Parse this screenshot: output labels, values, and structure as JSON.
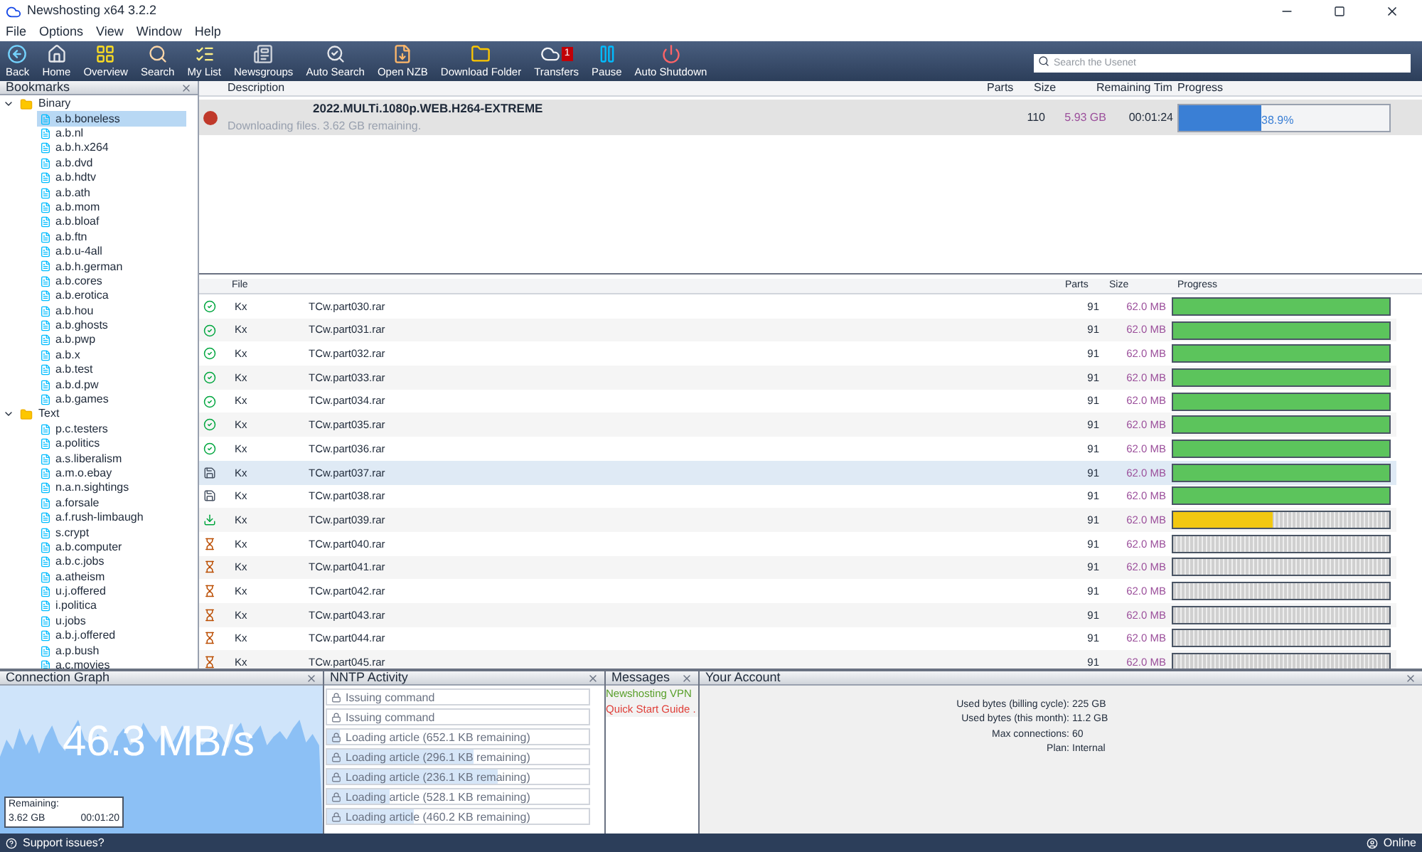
{
  "window": {
    "title": "Newshosting x64 3.2.2"
  },
  "menu": [
    "File",
    "Options",
    "View",
    "Window",
    "Help"
  ],
  "toolbar": [
    {
      "label": "Back"
    },
    {
      "label": "Home"
    },
    {
      "label": "Overview"
    },
    {
      "label": "Search"
    },
    {
      "label": "My List"
    },
    {
      "label": "Newsgroups"
    },
    {
      "label": "Auto Search"
    },
    {
      "label": "Open NZB"
    },
    {
      "label": "Download Folder"
    },
    {
      "label": "Transfers",
      "badge": "1"
    },
    {
      "label": "Pause"
    },
    {
      "label": "Auto Shutdown"
    }
  ],
  "search": {
    "placeholder": "Search the Usenet"
  },
  "bookmarks": {
    "title": "Bookmarks",
    "groups": [
      {
        "label": "Binary",
        "expanded": true,
        "children": [
          {
            "label": "a.b.boneless",
            "selected": true
          },
          {
            "label": "a.b.nl",
            "selected": false
          },
          {
            "label": "a.b.h.x264",
            "selected": false
          },
          {
            "label": "a.b.dvd",
            "selected": false
          },
          {
            "label": "a.b.hdtv",
            "selected": false
          },
          {
            "label": "a.b.ath",
            "selected": false
          },
          {
            "label": "a.b.mom",
            "selected": false
          },
          {
            "label": "a.b.bloaf",
            "selected": false
          },
          {
            "label": "a.b.ftn",
            "selected": false
          },
          {
            "label": "a.b.u-4all",
            "selected": false
          },
          {
            "label": "a.b.h.german",
            "selected": false
          },
          {
            "label": "a.b.cores",
            "selected": false
          },
          {
            "label": "a.b.erotica",
            "selected": false
          },
          {
            "label": "a.b.hou",
            "selected": false
          },
          {
            "label": "a.b.ghosts",
            "selected": false
          },
          {
            "label": "a.b.pwp",
            "selected": false
          },
          {
            "label": "a.b.x",
            "selected": false
          },
          {
            "label": "a.b.test",
            "selected": false
          },
          {
            "label": "a.b.d.pw",
            "selected": false
          },
          {
            "label": "a.b.games",
            "selected": false
          }
        ]
      },
      {
        "label": "Text",
        "expanded": true,
        "children": [
          {
            "label": "p.c.testers",
            "selected": false
          },
          {
            "label": "a.politics",
            "selected": false
          },
          {
            "label": "a.s.liberalism",
            "selected": false
          },
          {
            "label": "a.m.o.ebay",
            "selected": false
          },
          {
            "label": "n.a.n.sightings",
            "selected": false
          },
          {
            "label": "a.forsale",
            "selected": false
          },
          {
            "label": "a.f.rush-limbaugh",
            "selected": false
          },
          {
            "label": "s.crypt",
            "selected": false
          },
          {
            "label": "a.b.computer",
            "selected": false
          },
          {
            "label": "a.b.c.jobs",
            "selected": false
          },
          {
            "label": "a.atheism",
            "selected": false
          },
          {
            "label": "u.j.offered",
            "selected": false
          },
          {
            "label": "i.politica",
            "selected": false
          },
          {
            "label": "u.jobs",
            "selected": false
          },
          {
            "label": "a.b.j.offered",
            "selected": false
          },
          {
            "label": "a.p.bush",
            "selected": false
          },
          {
            "label": "a.c.movies",
            "selected": false
          }
        ]
      }
    ]
  },
  "jobs": {
    "columns": [
      "Description",
      "Parts",
      "Size",
      "Remaining Tim",
      "Progress"
    ],
    "rows": [
      {
        "title": "2022.MULTi.1080p.WEB.H264-EXTREME",
        "status": "Downloading files. 3.62 GB remaining.",
        "parts": "110",
        "size": "5.93 GB",
        "remaining": "00:01:24",
        "level": 0.389,
        "percent": "38.9%"
      }
    ]
  },
  "files": {
    "columns": [
      "File",
      "Parts",
      "Size",
      "Progress"
    ],
    "rows": [
      {
        "kind": "done",
        "poster": "Kx",
        "name": "TCw.part030.rar",
        "parts": "91",
        "size": "62.0 MB",
        "level": 1,
        "selected": false
      },
      {
        "kind": "done",
        "poster": "Kx",
        "name": "TCw.part031.rar",
        "parts": "91",
        "size": "62.0 MB",
        "level": 1,
        "selected": false
      },
      {
        "kind": "done",
        "poster": "Kx",
        "name": "TCw.part032.rar",
        "parts": "91",
        "size": "62.0 MB",
        "level": 1,
        "selected": false
      },
      {
        "kind": "done",
        "poster": "Kx",
        "name": "TCw.part033.rar",
        "parts": "91",
        "size": "62.0 MB",
        "level": 1,
        "selected": false
      },
      {
        "kind": "done",
        "poster": "Kx",
        "name": "TCw.part034.rar",
        "parts": "91",
        "size": "62.0 MB",
        "level": 1,
        "selected": false
      },
      {
        "kind": "done",
        "poster": "Kx",
        "name": "TCw.part035.rar",
        "parts": "91",
        "size": "62.0 MB",
        "level": 1,
        "selected": false
      },
      {
        "kind": "done",
        "poster": "Kx",
        "name": "TCw.part036.rar",
        "parts": "91",
        "size": "62.0 MB",
        "level": 1,
        "selected": false
      },
      {
        "kind": "saving",
        "poster": "Kx",
        "name": "TCw.part037.rar",
        "parts": "91",
        "size": "62.0 MB",
        "level": 1,
        "selected": true
      },
      {
        "kind": "saving",
        "poster": "Kx",
        "name": "TCw.part038.rar",
        "parts": "91",
        "size": "62.0 MB",
        "level": 1,
        "selected": false
      },
      {
        "kind": "downloading",
        "poster": "Kx",
        "name": "TCw.part039.rar",
        "parts": "91",
        "size": "62.0 MB",
        "level": 0.46,
        "selected": false
      },
      {
        "kind": "queued",
        "poster": "Kx",
        "name": "TCw.part040.rar",
        "parts": "91",
        "size": "62.0 MB",
        "selected": false
      },
      {
        "kind": "queued",
        "poster": "Kx",
        "name": "TCw.part041.rar",
        "parts": "91",
        "size": "62.0 MB",
        "selected": false
      },
      {
        "kind": "queued",
        "poster": "Kx",
        "name": "TCw.part042.rar",
        "parts": "91",
        "size": "62.0 MB",
        "selected": false
      },
      {
        "kind": "queued",
        "poster": "Kx",
        "name": "TCw.part043.rar",
        "parts": "91",
        "size": "62.0 MB",
        "selected": false
      },
      {
        "kind": "queued",
        "poster": "Kx",
        "name": "TCw.part044.rar",
        "parts": "91",
        "size": "62.0 MB",
        "selected": false
      },
      {
        "kind": "queued",
        "poster": "Kx",
        "name": "TCw.part045.rar",
        "parts": "91",
        "size": "62.0 MB",
        "selected": false
      }
    ]
  },
  "connection_graph": {
    "title": "Connection Graph",
    "speed": "46.3 MB/s",
    "remaining_label": "Remaining:",
    "remaining_size": "3.62 GB",
    "remaining_time": "00:01:20"
  },
  "nntp": {
    "title": "NNTP Activity",
    "items": [
      {
        "text": "Issuing command"
      },
      {
        "text": "Issuing command"
      },
      {
        "text": "Loading article (652.1 KB remaining)",
        "level": 0.05
      },
      {
        "text": "Loading article (296.1 KB remaining)",
        "level": 0.56
      },
      {
        "text": "Loading article (236.1 KB remaining)",
        "level": 0.65
      },
      {
        "text": "Loading article (528.1 KB remaining)",
        "level": 0.24
      },
      {
        "text": "Loading article (460.2 KB remaining)",
        "level": 0.33
      }
    ]
  },
  "messages": {
    "title": "Messages",
    "items": [
      {
        "text": "Newshosting VPN",
        "color": "#5aa02c"
      },
      {
        "text": "Quick Start Guide .",
        "color": "#e0403a"
      }
    ]
  },
  "account": {
    "title": "Your Account",
    "fields": [
      {
        "label": "Used bytes (billing cycle):",
        "value": "225 GB"
      },
      {
        "label": "Used bytes (this month):",
        "value": "11.2 GB"
      },
      {
        "label": "Max connections:",
        "value": "60"
      },
      {
        "label": "Plan:",
        "value": "Internal"
      }
    ]
  },
  "status_bar": {
    "support": "Support issues?",
    "connection": "Online"
  }
}
